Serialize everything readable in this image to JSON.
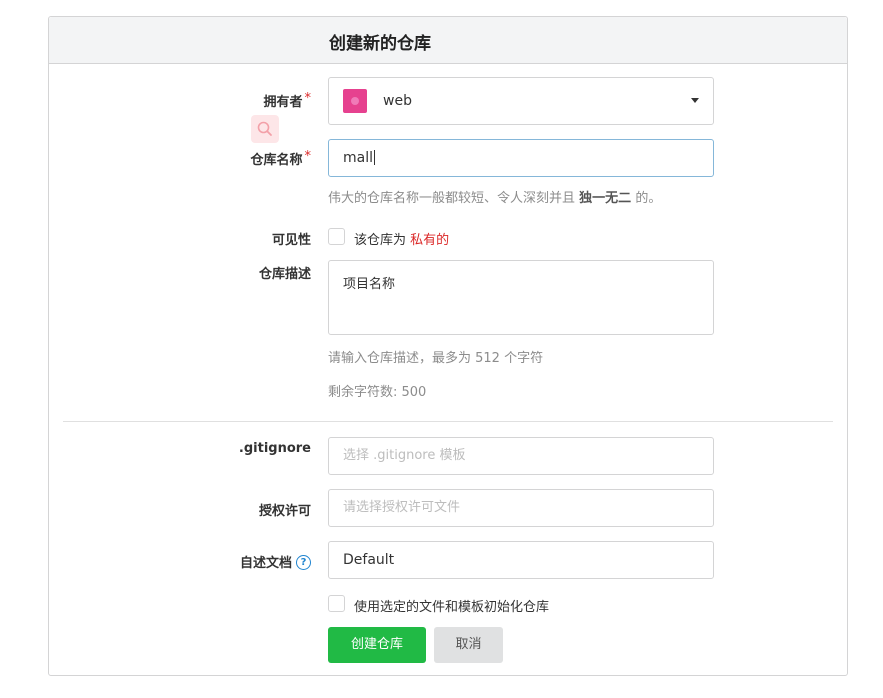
{
  "header": {
    "title": "创建新的仓库"
  },
  "owner": {
    "label": "拥有者",
    "required_mark": "*",
    "value": "web",
    "avatar_color": "#e6418f"
  },
  "repo_name": {
    "label": "仓库名称",
    "required_mark": "*",
    "value": "mall",
    "help_prefix": "伟大的仓库名称一般都较短、令人深刻并且",
    "help_bold": "独一无二",
    "help_suffix": "的。"
  },
  "visibility": {
    "label": "可见性",
    "checkbox_text": "该仓库为",
    "private_text": "私有的",
    "checked": false
  },
  "description": {
    "label": "仓库描述",
    "value": "项目名称",
    "help": "请输入仓库描述，最多为 512 个字符",
    "remaining": "剩余字符数: 500"
  },
  "gitignore": {
    "label": ".gitignore",
    "placeholder": "选择 .gitignore 模板"
  },
  "license": {
    "label": "授权许可",
    "placeholder": "请选择授权许可文件"
  },
  "readme": {
    "label": "自述文档",
    "help_icon": "?",
    "value": "Default"
  },
  "auto_init": {
    "checkbox_text": "使用选定的文件和模板初始化仓库",
    "checked": false
  },
  "buttons": {
    "create": "创建仓库",
    "cancel": "取消"
  },
  "colors": {
    "primary": "#21ba45",
    "required": "#db2828",
    "focus_border": "#85b7d9"
  }
}
